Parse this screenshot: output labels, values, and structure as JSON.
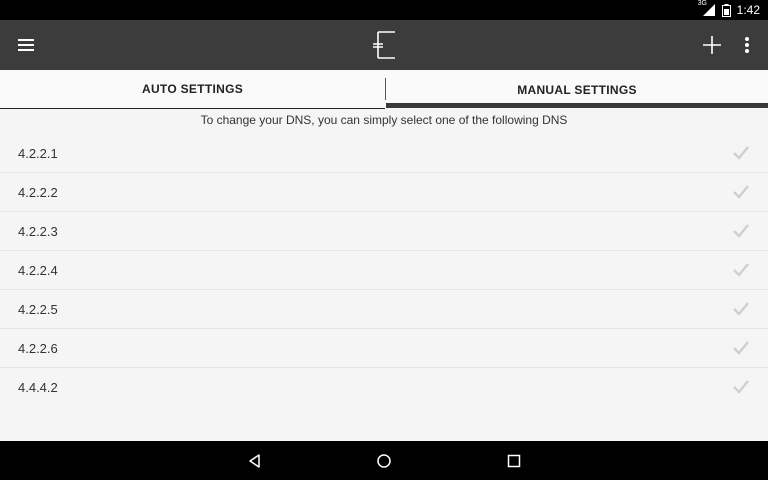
{
  "status_bar": {
    "network": "3G",
    "time": "1:42"
  },
  "app_bar": {
    "menu_icon": "menu-icon",
    "logo_icon": "app-logo-icon",
    "add_icon": "add-icon",
    "more_icon": "more-vert-icon"
  },
  "tabs": [
    {
      "label": "AUTO SETTINGS",
      "selected": false
    },
    {
      "label": "MANUAL SETTINGS",
      "selected": true
    }
  ],
  "description": "To change your DNS, you can simply select one of the following DNS",
  "dns_list": [
    {
      "label": "4.2.2.1"
    },
    {
      "label": "4.2.2.2"
    },
    {
      "label": "4.2.2.3"
    },
    {
      "label": "4.2.2.4"
    },
    {
      "label": "4.2.2.5"
    },
    {
      "label": "4.2.2.6"
    },
    {
      "label": "4.4.4.2"
    }
  ],
  "nav_bar": {
    "back": "back-icon",
    "home": "home-icon",
    "recents": "recents-icon"
  },
  "colors": {
    "app_bar": "#3c3c3c",
    "status_bar": "#000000",
    "background": "#f5f5f5",
    "check": "#cfcfcf"
  }
}
